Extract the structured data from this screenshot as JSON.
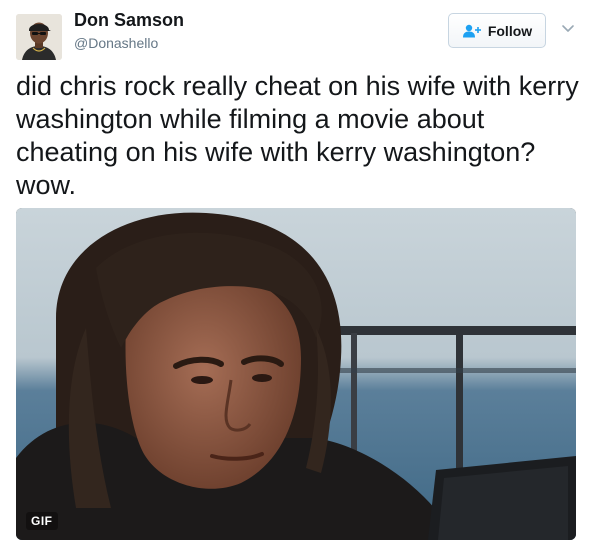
{
  "author": {
    "name": "Don Samson",
    "handle": "@Donashello",
    "avatar_icon": "user-avatar"
  },
  "actions": {
    "follow_label": "Follow",
    "follow_icon": "add-user-icon",
    "menu_icon": "chevron-down-icon"
  },
  "tweet": {
    "text": "did chris rock really cheat on his wife with kerry washington while filming a movie about cheating on his wife with kerry washington? wow."
  },
  "media": {
    "badge": "GIF"
  },
  "colors": {
    "text": "#14171a",
    "secondary": "#657786",
    "accent": "#1da1f2",
    "border": "#c7d5e1"
  }
}
